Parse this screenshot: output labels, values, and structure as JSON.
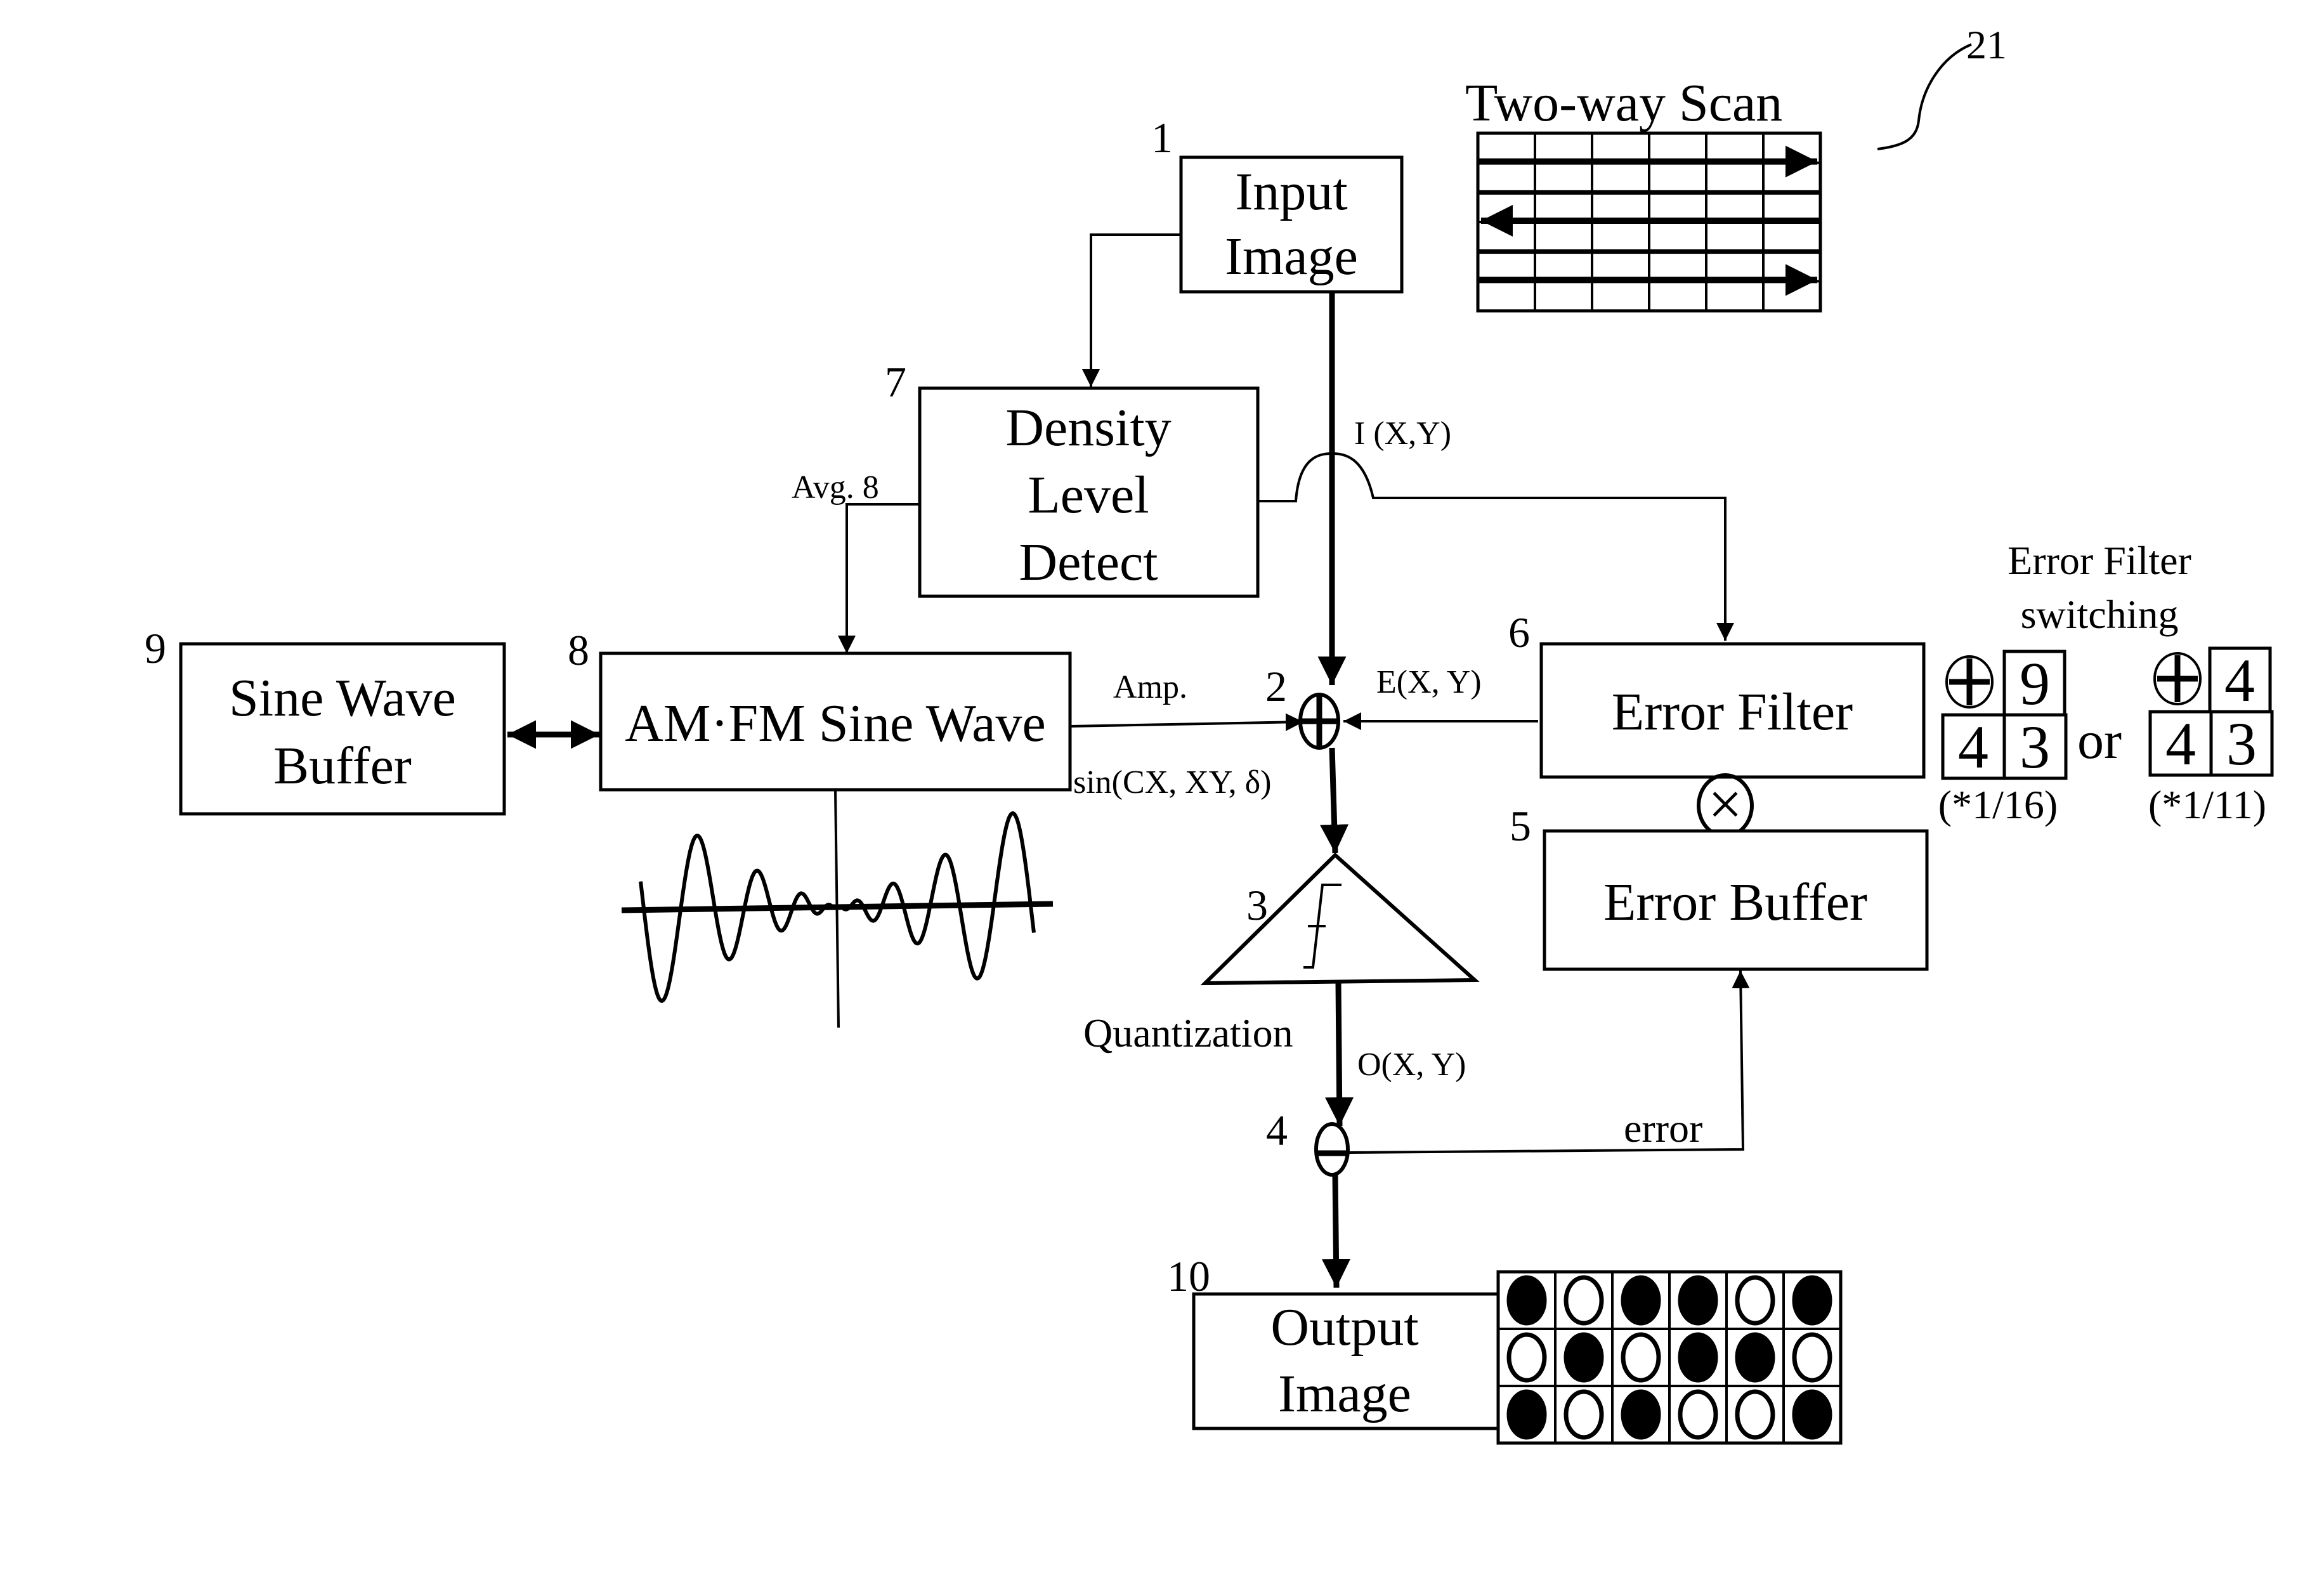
{
  "figure": {
    "reference_numeral": "21",
    "scan_title": "Two-way Scan"
  },
  "blocks": {
    "input_image": {
      "number": "1",
      "line1": "Input",
      "line2": "Image"
    },
    "adder": {
      "number": "2",
      "symbol": "⊕"
    },
    "quantizer": {
      "number": "3",
      "label": "Quantization"
    },
    "subtractor": {
      "number": "4",
      "symbol": "⊖"
    },
    "error_buffer": {
      "number": "5",
      "label": "Error Buffer"
    },
    "error_filter": {
      "number": "6",
      "label": "Error Filter"
    },
    "density_detect": {
      "number": "7",
      "line1": "Density",
      "line2": "Level",
      "line3": "Detect"
    },
    "am_fm_wave": {
      "number": "8",
      "label": "AM·FM Sine Wave"
    },
    "sine_buffer": {
      "number": "9",
      "line1": "Sine Wave",
      "line2": "Buffer"
    },
    "output_image": {
      "number": "10",
      "line1": "Output",
      "line2": "Image"
    }
  },
  "signals": {
    "input": "I (X,Y)",
    "error_in": "E(X, Y)",
    "output": "O(X, Y)",
    "amp": "Amp.",
    "sine": "sin(CX, XY, δ)",
    "avg": "Avg. 8",
    "error": "error",
    "multiply": "⊗"
  },
  "error_filter_switching": {
    "title_line1": "Error Filter",
    "title_line2": "switching",
    "or_label": "or",
    "filter_a": {
      "top": "9",
      "bottom_left": "4",
      "bottom_right": "3",
      "scale": "(*1/16)",
      "origin": "⊕"
    },
    "filter_b": {
      "top": "4",
      "bottom_left": "4",
      "bottom_right": "3",
      "scale": "(*1/11)",
      "origin": "⊕"
    }
  },
  "scan_grid": {
    "rows": 6,
    "cols": 6,
    "arrow_directions": [
      "right",
      "left",
      "right"
    ]
  },
  "output_grid": {
    "rows": [
      [
        1,
        0,
        1,
        1,
        0,
        1
      ],
      [
        0,
        1,
        0,
        1,
        1,
        0
      ],
      [
        1,
        0,
        1,
        0,
        0,
        1
      ]
    ]
  }
}
